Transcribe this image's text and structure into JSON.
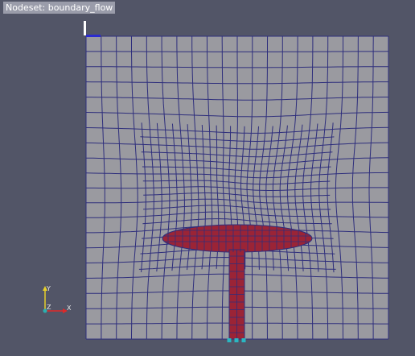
{
  "window": {
    "background": "#525567"
  },
  "label": {
    "text": "Nodeset: boundary_flow",
    "background": "#9a9caa"
  },
  "mesh": {
    "face_color": "#9a9aa0",
    "edge_color": "#2e2e7c",
    "nodeset_color": "#9b2436",
    "marker_color": "#2ab7c2"
  },
  "axes": {
    "x_label": "X",
    "y_label": "Y",
    "z_label": "Z",
    "x_color": "#e02828",
    "y_color": "#e6d02a",
    "z_color": "#2ab0b0"
  },
  "icons": {
    "orientation": "axes-triad-icon",
    "pick": "pick-marker-icon"
  }
}
